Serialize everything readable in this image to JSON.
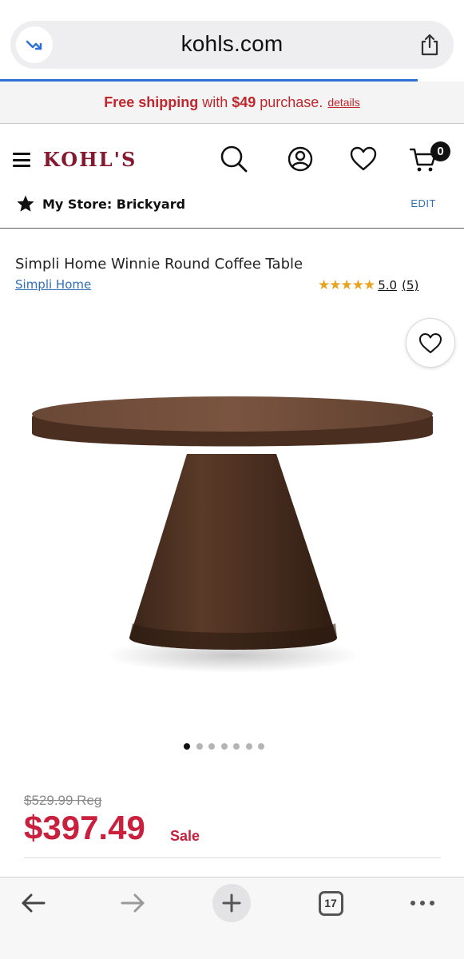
{
  "browser": {
    "url": "kohls.com",
    "tab_count": "17"
  },
  "promo": {
    "lead": "Free shipping",
    "mid": "with",
    "amount": "$49",
    "tail": "purchase.",
    "link": "details"
  },
  "header": {
    "logo": "KOHL'S",
    "cart_count": "0"
  },
  "store": {
    "label": "My Store: Brickyard",
    "edit": "EDIT"
  },
  "product": {
    "title": "Simpli Home Winnie Round Coffee Table",
    "brand": "Simpli Home",
    "stars": "★★★★★",
    "rating": "5.0",
    "review_count": "(5)",
    "image_count": 7,
    "active_image": 0,
    "reg_price": "$529.99 Reg",
    "sale_price": "$397.49",
    "sale_label": "Sale"
  },
  "colors": {
    "brand": "#85192f",
    "sale": "#c8203d",
    "link": "#2f6fb8",
    "star": "#e8a320"
  }
}
